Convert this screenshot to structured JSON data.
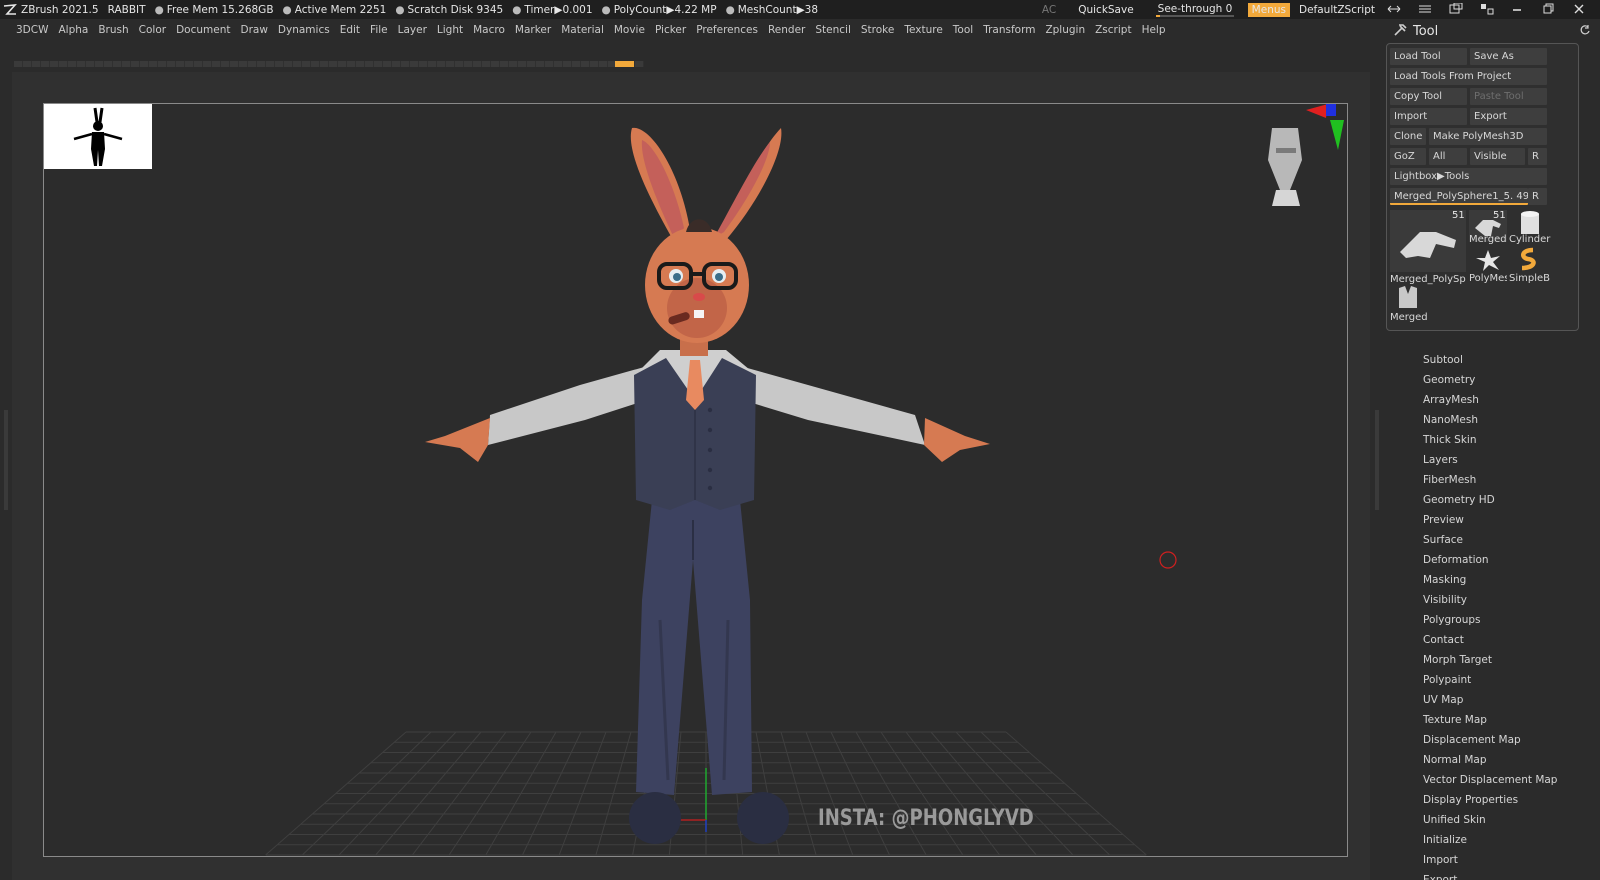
{
  "titlebar": {
    "app": "ZBrush 2021.5",
    "project": "RABBIT",
    "free_mem": "Free Mem 15.268GB",
    "active_mem": "Active Mem 2251",
    "scratch_disk": "Scratch Disk 9345",
    "timer": "Timer▶0.001",
    "polycount": "PolyCount▶4.22 MP",
    "meshcount": "MeshCount▶38",
    "ac": "AC",
    "quicksave": "QuickSave",
    "see_through_label": "See-through  0",
    "see_through_value": 0.05,
    "menus": "Menus",
    "default_zscript": "DefaultZScript"
  },
  "menubar": [
    "3DCW",
    "Alpha",
    "Brush",
    "Color",
    "Document",
    "Draw",
    "Dynamics",
    "Edit",
    "File",
    "Layer",
    "Light",
    "Macro",
    "Marker",
    "Material",
    "Movie",
    "Picker",
    "Preferences",
    "Render",
    "Stencil",
    "Stroke",
    "Texture",
    "Tool",
    "Transform",
    "Zplugin",
    "Zscript",
    "Help"
  ],
  "watermark": "INSTA: @PHONGLYVD",
  "panel": {
    "title": "Tool",
    "load_tool": "Load Tool",
    "save_as": "Save As",
    "load_tools_from_project": "Load Tools From Project",
    "copy_tool": "Copy Tool",
    "paste_tool": "Paste Tool",
    "import": "Import",
    "export": "Export",
    "clone": "Clone",
    "make_polymesh": "Make PolyMesh3D",
    "goz": "GoZ",
    "all": "All",
    "visible": "Visible",
    "r": "R",
    "lightbox_tools": "Lightbox▶Tools",
    "current_tool": "Merged_PolySphere1_5. 49",
    "r2": "R",
    "tiles": [
      {
        "label": "Merged_PolySph",
        "count": "51"
      },
      {
        "label": "Merged",
        "count": "51"
      },
      {
        "label": "Cylinder",
        "count": ""
      },
      {
        "label": "PolyMes",
        "count": ""
      },
      {
        "label": "SimpleB",
        "count": ""
      },
      {
        "label": "Merged",
        "count": ""
      }
    ],
    "subpalettes": [
      "Subtool",
      "Geometry",
      "ArrayMesh",
      "NanoMesh",
      "Thick Skin",
      "Layers",
      "FiberMesh",
      "Geometry HD",
      "Preview",
      "Surface",
      "Deformation",
      "Masking",
      "Visibility",
      "Polygroups",
      "Contact",
      "Morph Target",
      "Polypaint",
      "UV Map",
      "Texture Map",
      "Displacement Map",
      "Normal Map",
      "Vector Displacement Map",
      "Display Properties",
      "Unified Skin",
      "Initialize",
      "Import",
      "Export"
    ]
  },
  "colors": {
    "accent": "#f2a93b",
    "skin": "#d67a52",
    "shirt": "#c8c8c8",
    "vest": "#3a3f55",
    "tie": "#e88a60"
  }
}
